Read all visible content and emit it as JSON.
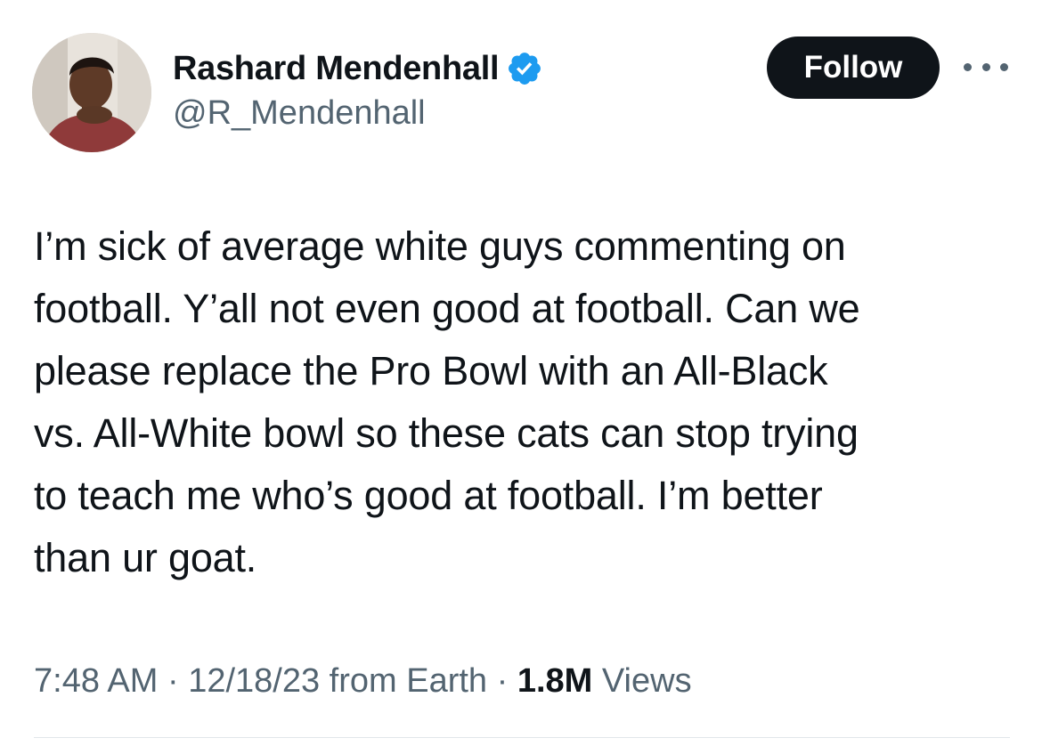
{
  "author": {
    "display_name": "Rashard Mendenhall",
    "handle": "@R_Mendenhall",
    "verified": true,
    "verified_color": "#1d9bf0"
  },
  "actions": {
    "follow_label": "Follow"
  },
  "tweet": {
    "text_lines": [
      "I’m sick of average white guys commenting on",
      "football. Y’all not even good at football. Can we",
      "please replace the Pro Bowl with an All-Black",
      "vs. All-White bowl so these cats can stop trying",
      "to teach me who’s good at football. I’m better",
      "than ur goat."
    ]
  },
  "meta": {
    "time": "7:48 AM",
    "separator": " · ",
    "date": "12/18/23",
    "source": " from Earth",
    "views_count": "1.8M",
    "views_label": " Views"
  },
  "colors": {
    "text_primary": "#0f1419",
    "text_secondary": "#536471",
    "follow_bg": "#0f1419",
    "divider": "#e1e6ea"
  }
}
